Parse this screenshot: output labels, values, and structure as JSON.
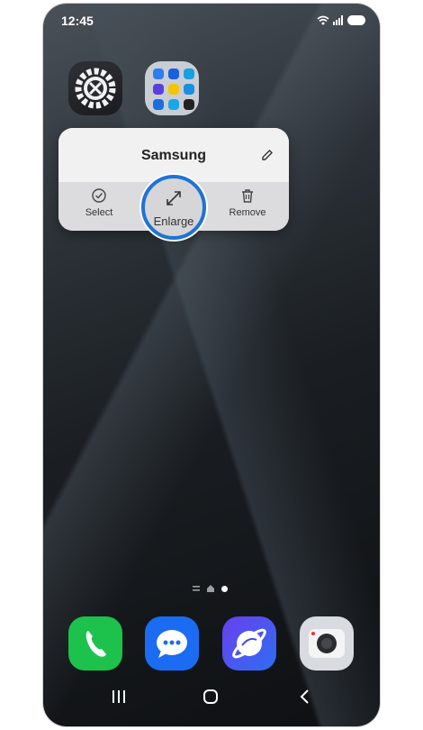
{
  "status_bar": {
    "time": "12:45"
  },
  "home": {
    "apps": [
      {
        "name": "Settings"
      },
      {
        "name": "Samsung folder"
      }
    ]
  },
  "popup": {
    "title": "Samsung",
    "actions": [
      {
        "label": "Select"
      },
      {
        "label": "Enlarge"
      },
      {
        "label": "Remove"
      }
    ]
  },
  "dock": [
    {
      "name": "Phone",
      "color": "#1cc24b"
    },
    {
      "name": "Messages",
      "color": "#1b6cf2"
    },
    {
      "name": "Internet",
      "color": "#3f49e6"
    },
    {
      "name": "Camera",
      "color": "#d9dbe0"
    }
  ],
  "colors": {
    "highlight": "#1f73d6"
  }
}
